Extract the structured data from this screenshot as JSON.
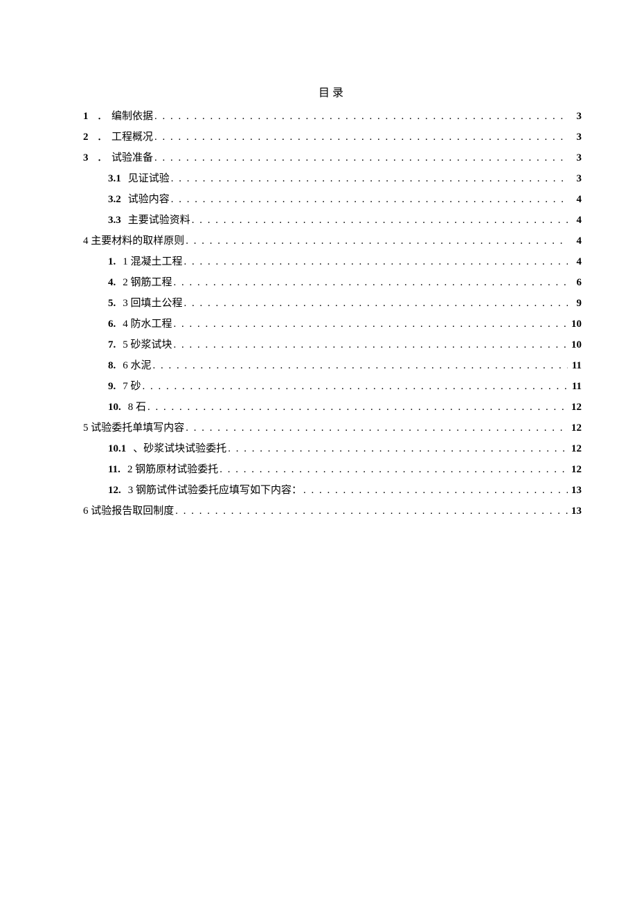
{
  "title": "目录",
  "entries": [
    {
      "level": 0,
      "num": "1",
      "sep": "．",
      "label": "编制依据",
      "page": "3"
    },
    {
      "level": 0,
      "num": "2",
      "sep": "．",
      "label": "工程概况",
      "page": "3"
    },
    {
      "level": 0,
      "num": "3",
      "sep": "．",
      "label": "试验准备",
      "page": "3"
    },
    {
      "level": 1,
      "num": "3.1",
      "sep": "",
      "label": "见证试验",
      "page": "3"
    },
    {
      "level": 1,
      "num": "3.2",
      "sep": "",
      "label": "试验内容",
      "page": "4"
    },
    {
      "level": 1,
      "num": "3.3",
      "sep": "",
      "label": "主要试验资料",
      "page": "4"
    },
    {
      "level": 0,
      "num": "",
      "sep": "",
      "label": "4 主要材料的取样原则",
      "page": "4"
    },
    {
      "level": 1,
      "num": "1.",
      "sep": "",
      "label": "1 混凝土工程",
      "page": "4"
    },
    {
      "level": 1,
      "num": "4.",
      "sep": "",
      "label": "2 钢筋工程",
      "page": "6"
    },
    {
      "level": 1,
      "num": "5.",
      "sep": "",
      "label": "3 回填土公程",
      "page": "9"
    },
    {
      "level": 1,
      "num": "6.",
      "sep": "",
      "label": "4 防水工程",
      "page": "10"
    },
    {
      "level": 1,
      "num": "7.",
      "sep": "",
      "label": "5 砂浆试块",
      "page": "10"
    },
    {
      "level": 1,
      "num": "8.",
      "sep": "",
      "label": "6 水泥",
      "page": "11"
    },
    {
      "level": 1,
      "num": "9.",
      "sep": "",
      "label": "7  砂",
      "page": "11"
    },
    {
      "level": 1,
      "num": "10.",
      "sep": "",
      "label": "8  石",
      "page": "12"
    },
    {
      "level": 0,
      "num": "",
      "sep": "",
      "label": "5 试验委托单填写内容",
      "page": "12"
    },
    {
      "level": 1,
      "num": "10.1",
      "sep": "",
      "label": "、砂浆试块试验委托",
      "page": "12"
    },
    {
      "level": 1,
      "num": "11.",
      "sep": "",
      "label": "2 钢筋原材试验委托",
      "page": "12"
    },
    {
      "level": 1,
      "num": "12.",
      "sep": "",
      "label": "3 钢筋试件试验委托应填写如下内容：",
      "page": "13"
    },
    {
      "level": 0,
      "num": "",
      "sep": "",
      "label": "6 试验报告取回制度",
      "page": "13"
    }
  ]
}
